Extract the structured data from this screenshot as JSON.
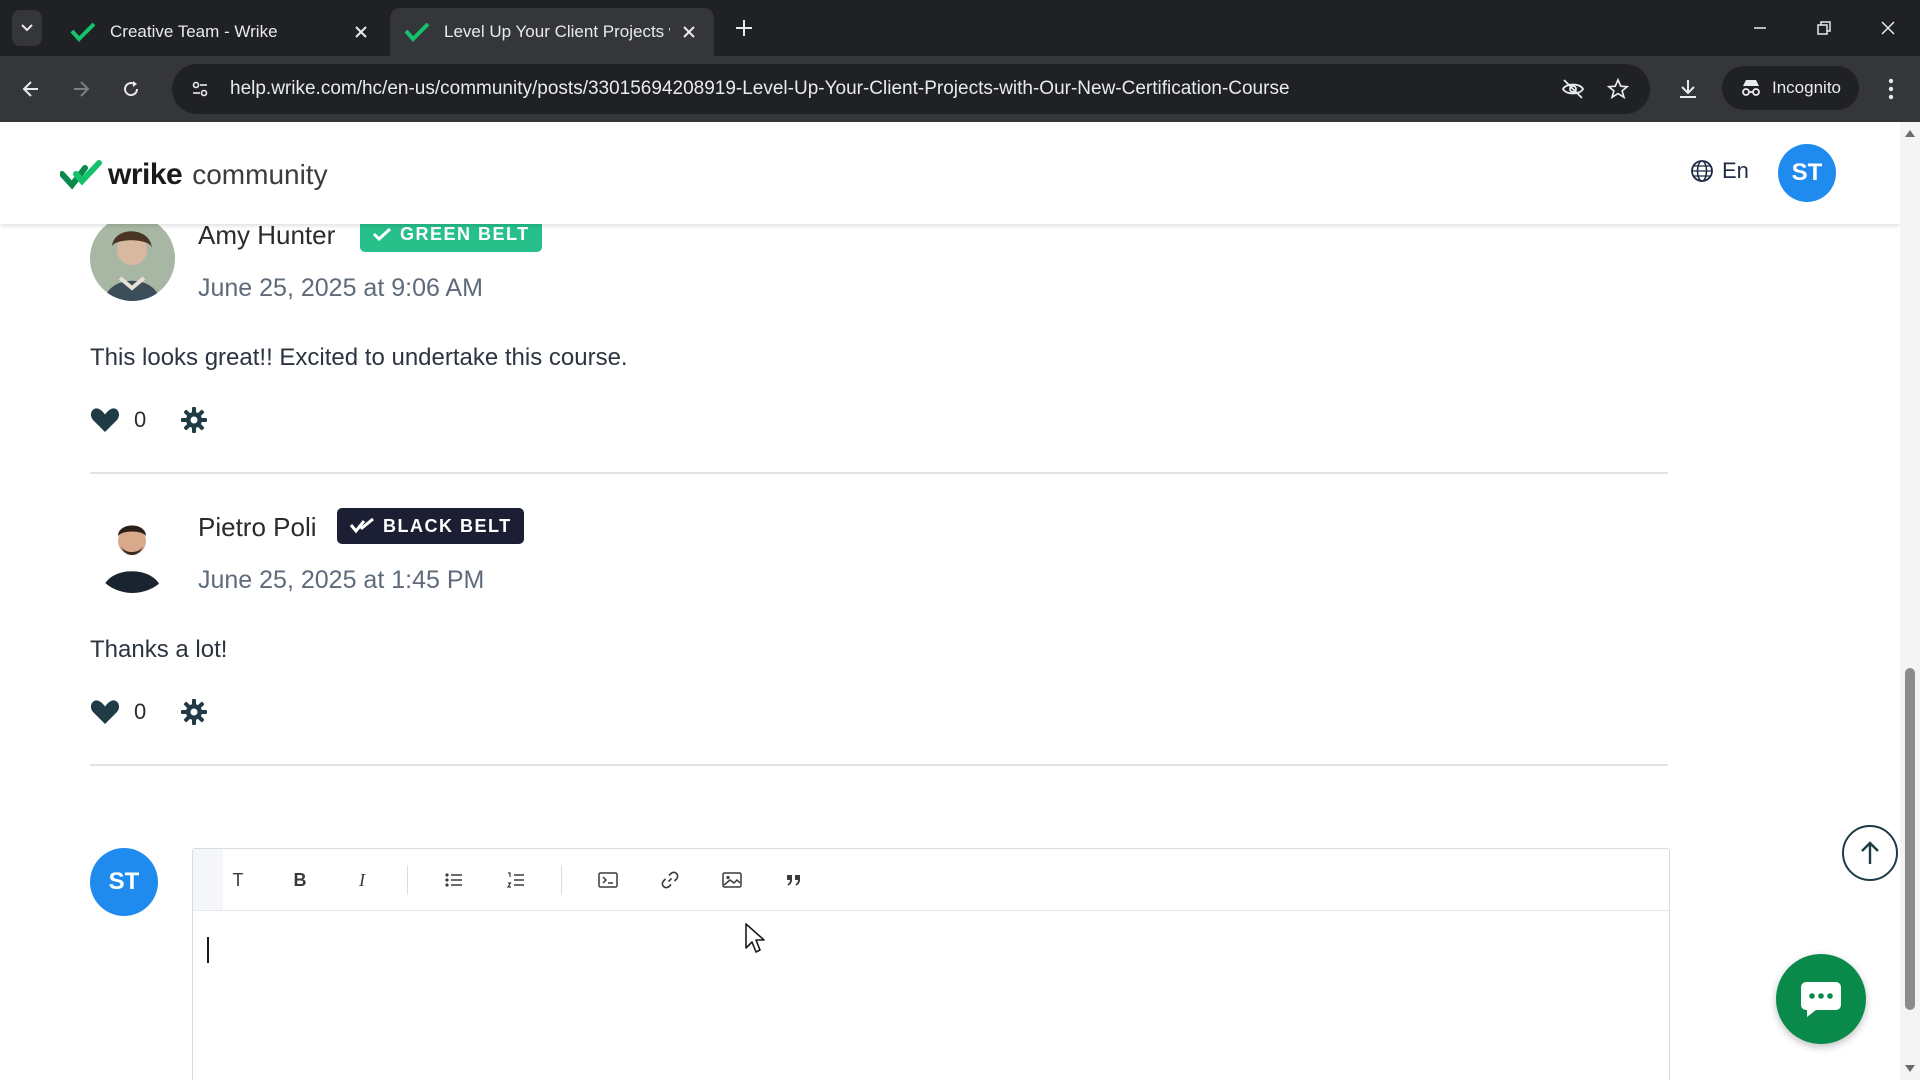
{
  "browser": {
    "tabs": [
      {
        "title": "Creative Team - Wrike",
        "active": false
      },
      {
        "title": "Level Up Your Client Projects wi",
        "active": true
      }
    ],
    "url": "help.wrike.com/hc/en-us/community/posts/33015694208919-Level-Up-Your-Client-Projects-with-Our-New-Certification-Course",
    "incognito_label": "Incognito",
    "favicon_color": "#15c26b"
  },
  "header": {
    "logo_word": "wrike",
    "logo_suffix": "community",
    "language": "En",
    "user_initials": "ST"
  },
  "comments": [
    {
      "author": "Amy Hunter",
      "badge": "GREEN BELT",
      "badge_color": "#27c08a",
      "date": "June 25, 2025 at 9:06 AM",
      "body": "This looks great!! Excited to undertake this course.",
      "votes": "0"
    },
    {
      "author": "Pietro Poli",
      "badge": "BLACK BELT",
      "badge_color": "#1c1f33",
      "date": "June 25, 2025 at 1:45 PM",
      "body": "Thanks a lot!",
      "votes": "0"
    }
  ],
  "reply": {
    "avatar_initials": "ST",
    "toolbar": {
      "text_label": "T",
      "bold_label": "B",
      "italic_label": "I",
      "icons": [
        "bulleted-list-icon",
        "numbered-list-icon",
        "code-block-icon",
        "link-icon",
        "image-icon",
        "quote-icon"
      ]
    }
  },
  "colors": {
    "brand_green": "#0a8a4a",
    "avatar_blue": "#1f8bef",
    "heart": "#1f3b45"
  }
}
